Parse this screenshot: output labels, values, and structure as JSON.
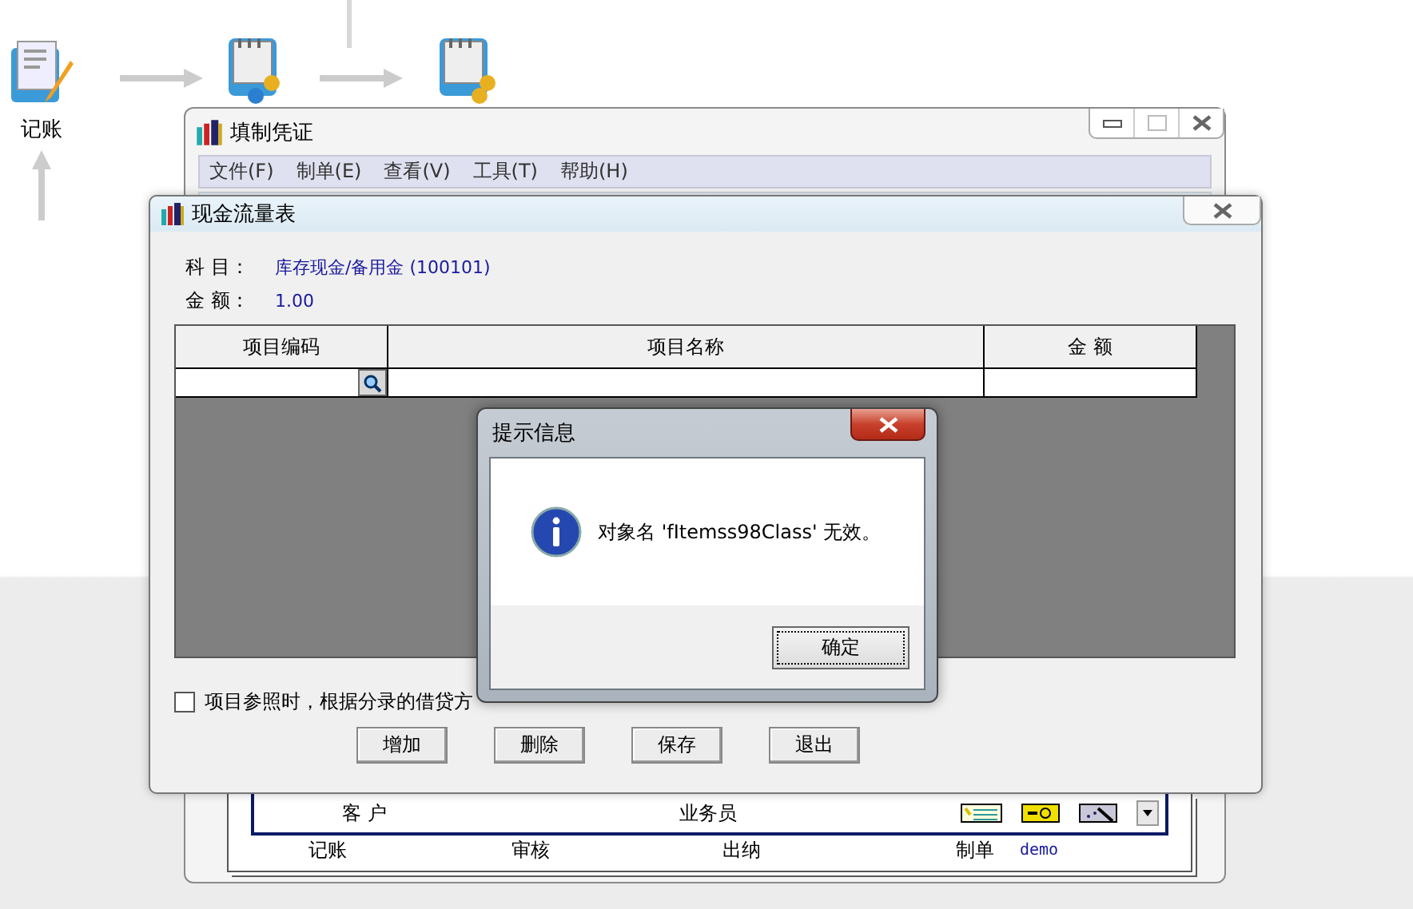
{
  "flow": {
    "label": "记账"
  },
  "back_window": {
    "title": "填制凭证",
    "menu": [
      "文件(F)",
      "制单(E)",
      "查看(V)",
      "工具(T)",
      "帮助(H)"
    ],
    "footer": {
      "customer_label": "客 户",
      "salesperson_label": "业务员",
      "signatures": [
        "记账",
        "审核",
        "出纳",
        "制单"
      ],
      "maker": "demo"
    }
  },
  "front_window": {
    "title": "现金流量表",
    "fields": [
      {
        "label": "科 目：",
        "value": "库存现金/备用金 (100101)"
      },
      {
        "label": "金 额：",
        "value": "1.00"
      }
    ],
    "table": {
      "columns": [
        "项目编码",
        "项目名称",
        "金 额"
      ]
    },
    "checkbox": {
      "label": "项目参照时，根据分录的借贷方",
      "checked": false
    },
    "buttons": [
      "增加",
      "删除",
      "保存",
      "退出"
    ]
  },
  "dialog": {
    "title": "提示信息",
    "message": "对象名 'fItemss98Class' 无效。",
    "button": "确定"
  }
}
